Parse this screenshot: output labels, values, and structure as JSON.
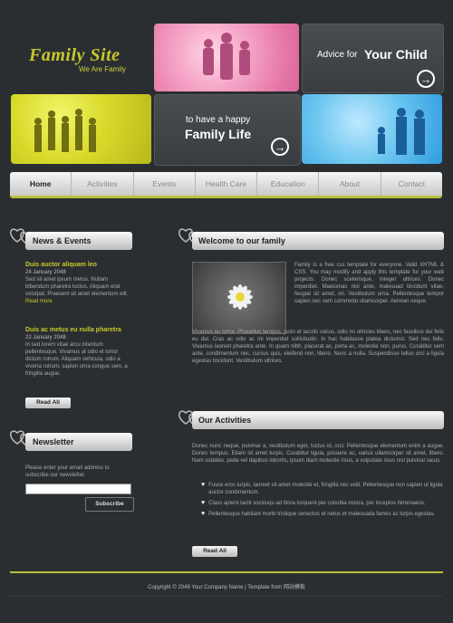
{
  "logo": {
    "title": "Family Site",
    "subtitle": "We Are Family"
  },
  "tiles": {
    "advice": {
      "small": "Advice for",
      "big": "Your Child"
    },
    "family": {
      "small": "to have a happy",
      "big": "Family Life"
    }
  },
  "nav": {
    "items": [
      "Home",
      "Activities",
      "Events",
      "Health Care",
      "Education",
      "About",
      "Contact"
    ]
  },
  "news": {
    "title": "News & Events",
    "items": [
      {
        "title": "Duis auctor aliquam leo",
        "date": "24 January 2048",
        "text": "Sed sit amet ipsum metus. Nullam bibendum pharetra luctus. Aliquam erat volutpat. Praesent sit amet elementum elit.",
        "more": "Read more"
      },
      {
        "title": "Duis ac metus eu nulla pharetra",
        "date": "22 January 2048",
        "text": "In sed lorem vitae arcu interdum pellentesque. Vivamus at odio et tortor dictum rutrum. Aliquam vehicula, odio a viverra rutrum, sapien urna congue sem, a fringilla augue."
      }
    ],
    "button": "Read All"
  },
  "newsletter": {
    "title": "Newsletter",
    "text": "Please enter your email address to subscribe our newsletter.",
    "placeholder": "",
    "button": "Subscribe"
  },
  "welcome": {
    "title": "Welcome to our family",
    "p1": "Family is a free css template for everyone. Valid XHTML & CSS. You may modify and apply this template for your web projects. Donec scelerisque, Integer ultrices. Donec imperdiet. Maecenas nisl ante, malesuad tincidunt vitae, feugiat sit amet, mi. Vestibulum urna. Pellentesque tempor sapien nec sem commodo ullamcorper. Aenean neque.",
    "p2": "Vivamus eu tortor. Phasellus tempus, justo et iaculis varius, odio mi ultricies libero, nec faucibus dui felis eu dui. Cras ac odio ac mi imperdiet sollicitudin. In hac habitasse platea dictumst. Sed nec felis. Vivamus laoreet pharetra ante. In quam nibh, placerat ac, porta ac, molestie non, purus. Curabitur sem ante, condimentum nec, cursus quis, eleifend non, libero. Nunc a nulla. Suspendisse tellus orci a ligula egestas tincidunt. Vestibulum ultrices."
  },
  "activities": {
    "title": "Our Activities",
    "intro": "Donec nunc neque, pulvinar a, vestibulum eget, luctus id, orci. Pellentesque elementum enim a augue. Donec tempus. Etiam sit amet turpis. Curabitur ligula, posuere ac, varius ullamcorper sit amet, libero. Nam sodales, pede vel dapibus lobortis, ipsum diam molestie risus, a vulputate risus nisl pulvinar lacus.",
    "bullets": [
      "Fusce eros turpis, laoreet sit amet molestie et, fringilla nec velit. Pellentesque non sapien ut ligula auctor condimentum.",
      "Class aptent taciti sociosqu ad litora torquent per conubia nostra, per inceptos himenaeos.",
      "Pellentesque habitant morbi tristique senectus et netus et malesuada fames ac turpis egestas."
    ],
    "button": "Read All"
  },
  "footer": {
    "text": "Copyright © 2048 Your Company Name | Template from 网站模板"
  },
  "colors": {
    "accent": "#c7c92a",
    "bg": "#2b2e31",
    "pink": "#f6a8c9",
    "yellow": "#d8da2a",
    "blue": "#6ec7f0"
  }
}
